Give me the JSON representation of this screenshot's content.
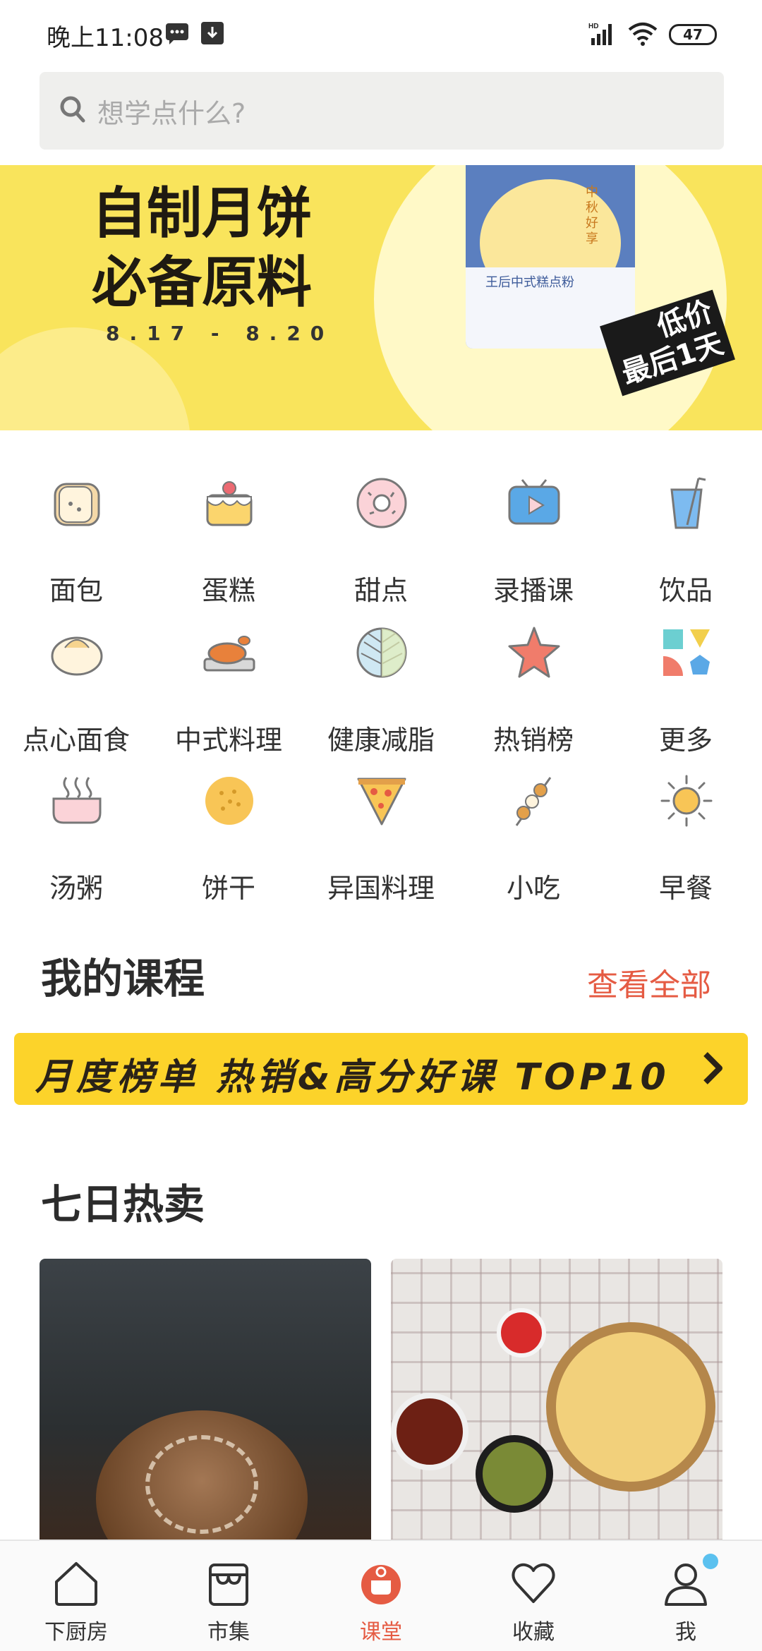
{
  "status_bar": {
    "time": "晚上11:08",
    "battery": "47",
    "icons": [
      "message-icon",
      "download-icon",
      "signal-icon",
      "wifi-icon",
      "battery-icon"
    ]
  },
  "search": {
    "placeholder": "想学点什么?"
  },
  "banner": {
    "title_line1": "自制月饼",
    "title_line2": "必备原料",
    "date": "8.17 - 8.20",
    "bag_text": "王后中式糕点粉",
    "bag_vertical": "中秋好享",
    "promo_line1": "低价",
    "promo_line2": "最后1天"
  },
  "categories": [
    {
      "label": "面包",
      "icon": "bread-icon"
    },
    {
      "label": "蛋糕",
      "icon": "cake-icon"
    },
    {
      "label": "甜点",
      "icon": "donut-icon"
    },
    {
      "label": "录播课",
      "icon": "tv-icon"
    },
    {
      "label": "饮品",
      "icon": "drink-icon"
    },
    {
      "label": "点心面食",
      "icon": "bun-icon"
    },
    {
      "label": "中式料理",
      "icon": "roast-chicken-icon"
    },
    {
      "label": "健康减脂",
      "icon": "leaf-icon"
    },
    {
      "label": "热销榜",
      "icon": "star-icon"
    },
    {
      "label": "更多",
      "icon": "shapes-icon"
    },
    {
      "label": "汤粥",
      "icon": "pot-icon"
    },
    {
      "label": "饼干",
      "icon": "cookie-icon"
    },
    {
      "label": "异国料理",
      "icon": "pizza-icon"
    },
    {
      "label": "小吃",
      "icon": "skewer-icon"
    },
    {
      "label": "早餐",
      "icon": "sun-icon"
    }
  ],
  "my_courses": {
    "title": "我的课程",
    "view_all": "查看全部",
    "top_banner": "月度榜单 热销&高分好课 TOP10"
  },
  "seven_day": {
    "title": "七日热卖"
  },
  "tabs": [
    {
      "label": "下厨房",
      "icon": "home-icon",
      "active": false
    },
    {
      "label": "市集",
      "icon": "market-icon",
      "active": false
    },
    {
      "label": "课堂",
      "icon": "classroom-icon",
      "active": true
    },
    {
      "label": "收藏",
      "icon": "heart-icon",
      "active": false
    },
    {
      "label": "我",
      "icon": "profile-icon",
      "active": false
    }
  ],
  "colors": {
    "accent": "#e55b43",
    "banner_yellow": "#f9e45c",
    "top_banner_yellow": "#fcd32a",
    "notification_dot": "#5bc1ef"
  }
}
